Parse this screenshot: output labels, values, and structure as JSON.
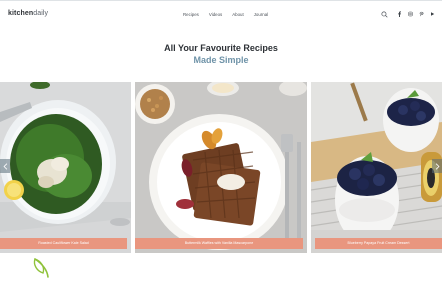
{
  "brand": {
    "name_bold": "kitchen",
    "name_light": "daily"
  },
  "nav": {
    "items": [
      {
        "label": "Recipes"
      },
      {
        "label": "Videos"
      },
      {
        "label": "About"
      },
      {
        "label": "Journal"
      }
    ]
  },
  "header_icons": [
    "search-icon",
    "facebook-icon",
    "instagram-icon",
    "pinterest-icon",
    "youtube-icon"
  ],
  "hero": {
    "title": "All Your Favourite Recipes",
    "subtitle": "Made Simple"
  },
  "slider": {
    "slides": [
      {
        "caption": "Roasted Cauliflower Kale Salad"
      },
      {
        "caption": "Buttermilk Waffles with Vanilla Mascarpone"
      },
      {
        "caption": "Blueberry Papaya Fruit Cream Dessert"
      }
    ]
  },
  "colors": {
    "caption_bg": "#e9967f",
    "subtitle": "#6f93a8",
    "accent_leaf": "#8fc23a"
  }
}
